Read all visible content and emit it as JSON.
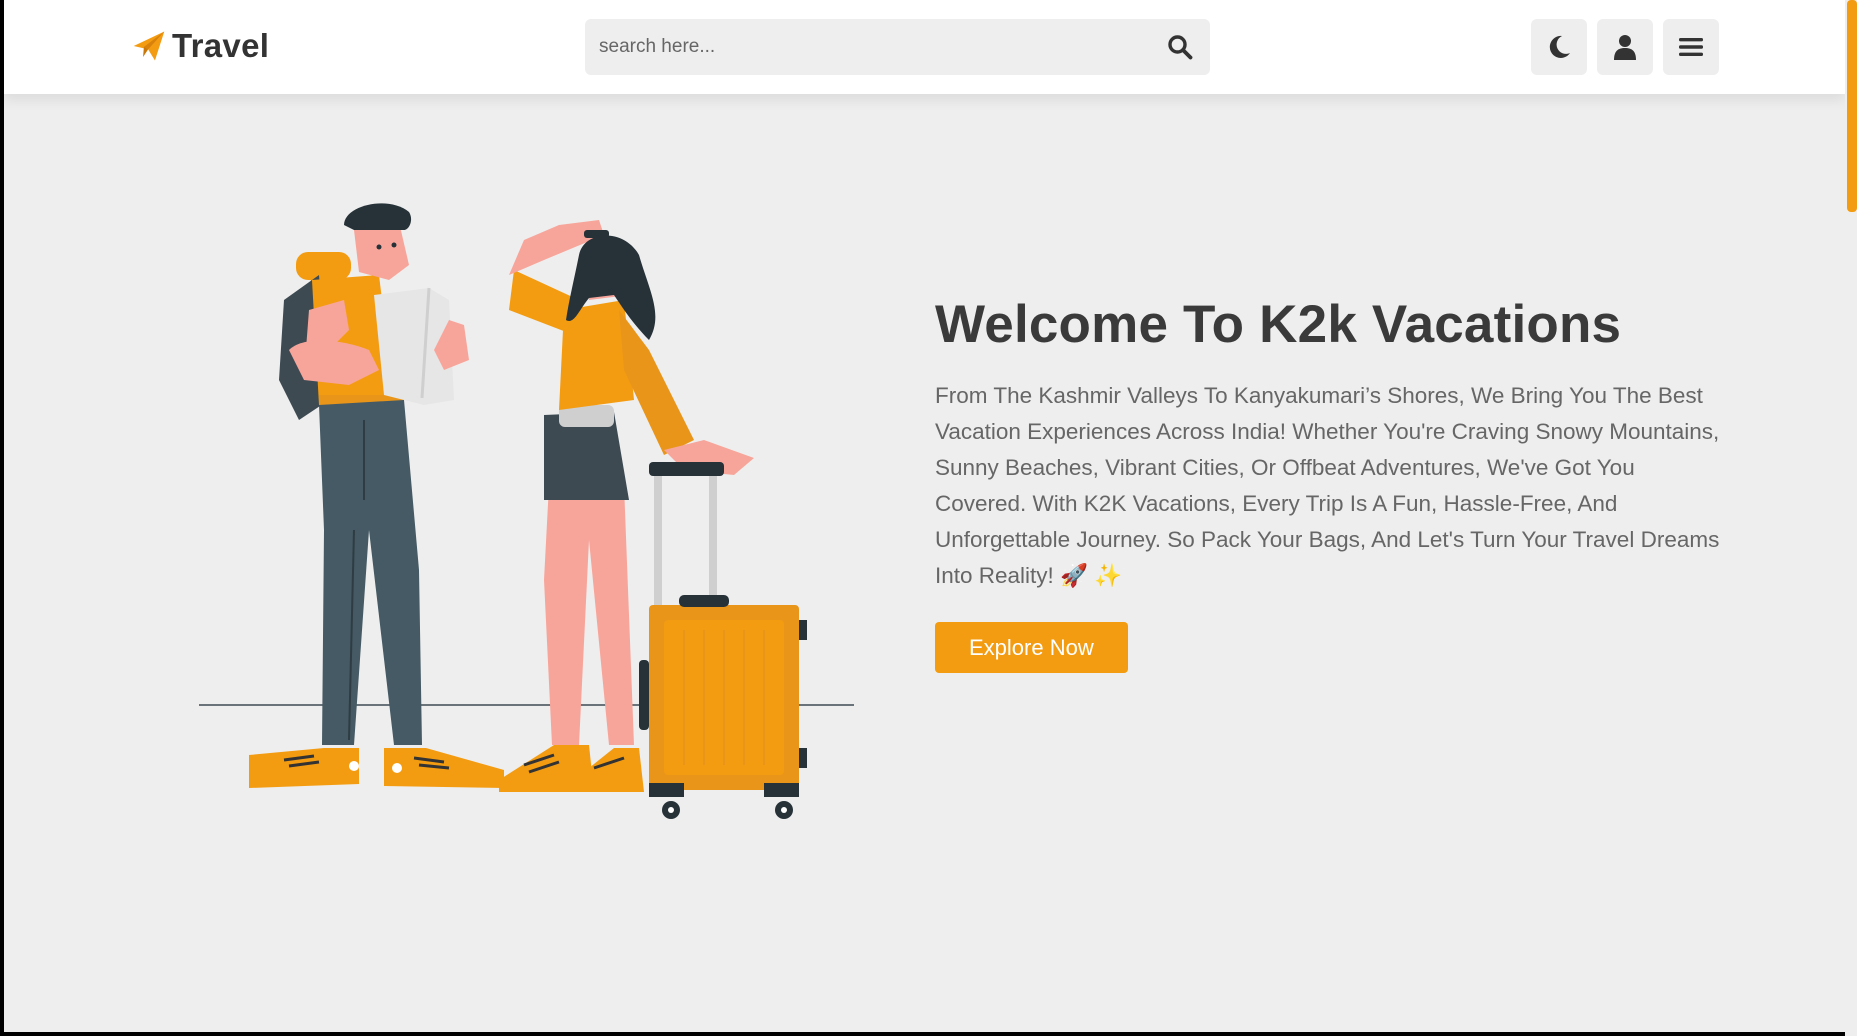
{
  "header": {
    "logo_text": "Travel",
    "search": {
      "placeholder": "search here..."
    },
    "icons": [
      "paper-plane-icon",
      "search-icon",
      "moon-icon",
      "user-icon",
      "menu-icon"
    ]
  },
  "hero": {
    "title": "Welcome To K2k Vacations",
    "description": "From The Kashmir Valleys To Kanyakumari’s Shores, We Bring You The Best Vacation Experiences Across India! Whether You're Craving Snowy Mountains, Sunny Beaches, Vibrant Cities, Or Offbeat Adventures, We've Got You Covered. With K2K Vacations, Every Trip Is A Fun, Hassle-Free, And Unforgettable Journey. So Pack Your Bags, And Let's Turn Your Travel Dreams Into Reality! 🚀 ✨",
    "cta_label": "Explore Now"
  },
  "colors": {
    "accent": "#f39c12",
    "text_dark": "#3a3a3a",
    "text_body": "#666666",
    "background": "#eeeeee"
  }
}
